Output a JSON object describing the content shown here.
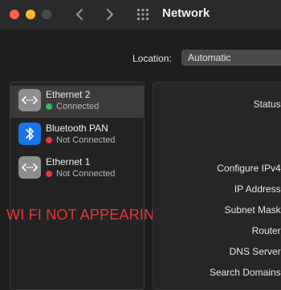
{
  "window": {
    "title": "Network"
  },
  "location": {
    "label": "Location:",
    "value": "Automatic"
  },
  "services": [
    {
      "name": "Ethernet 2",
      "status": "Connected",
      "status_color": "#2dbf4f",
      "icon": "ethernet-icon"
    },
    {
      "name": "Bluetooth PAN",
      "status": "Not Connected",
      "status_color": "#e33b3b",
      "icon": "bluetooth-icon"
    },
    {
      "name": "Ethernet 1",
      "status": "Not Connected",
      "status_color": "#e33b3b",
      "icon": "ethernet-icon"
    }
  ],
  "details": {
    "status": "Status:",
    "configure_ipv4": "Configure IPv4:",
    "ip_address": "IP Address:",
    "subnet_mask": "Subnet Mask:",
    "router": "Router:",
    "dns_server": "DNS Server:",
    "search_domains": "Search Domains:"
  },
  "annotation": "WI FI NOT APPEARING",
  "colors": {
    "accent_red": "#e53935",
    "bluetooth_blue": "#1a73e8"
  }
}
